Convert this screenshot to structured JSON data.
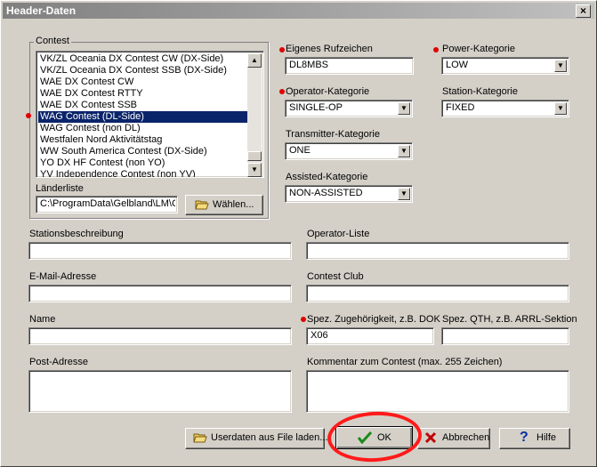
{
  "window": {
    "title": "Header-Daten",
    "close_glyph": "×"
  },
  "contest": {
    "group_label": "Contest",
    "items": [
      "VK/ZL Oceania DX Contest CW (DX-Side)",
      "VK/ZL Oceania DX Contest SSB (DX-Side)",
      "WAE DX Contest CW",
      "WAE DX Contest RTTY",
      "WAE DX Contest SSB",
      "WAG Contest (DL-Side)",
      "WAG Contest (non DL)",
      "Westfalen Nord Aktivitätstag",
      "WW South America Contest (DX-Side)",
      "YO DX HF Contest (non YO)",
      "YV Independence Contest (non YV)"
    ],
    "selected_index": 5,
    "laenderliste_label": "Länderliste",
    "laenderliste_value": "C:\\ProgramData\\Gelbland\\LM\\C",
    "waehlen_label": "Wählen..."
  },
  "fields": {
    "rufzeichen_label": "Eigenes Rufzeichen",
    "rufzeichen_value": "DL8MBS",
    "power_label": "Power-Kategorie",
    "power_value": "LOW",
    "operator_label": "Operator-Kategorie",
    "operator_value": "SINGLE-OP",
    "station_label": "Station-Kategorie",
    "station_value": "FIXED",
    "transmitter_label": "Transmitter-Kategorie",
    "transmitter_value": "ONE",
    "assisted_label": "Assisted-Kategorie",
    "assisted_value": "NON-ASSISTED",
    "stationsbeschreibung_label": "Stationsbeschreibung",
    "stationsbeschreibung_value": "",
    "operator_liste_label": "Operator-Liste",
    "operator_liste_value": "",
    "email_label": "E-Mail-Adresse",
    "email_value": "",
    "club_label": "Contest Club",
    "club_value": "",
    "name_label": "Name",
    "name_value": "",
    "dok_label": "Spez. Zugehörigkeit, z.B. DOK",
    "dok_value": "X06",
    "qth_label": "Spez. QTH, z.B. ARRL-Sektion",
    "qth_value": "",
    "post_label": "Post-Adresse",
    "post_value": "",
    "kommentar_label": "Kommentar zum Contest (max. 255 Zeichen)",
    "kommentar_value": ""
  },
  "buttons": {
    "userdaten_label": "Userdaten aus File laden...",
    "ok_label": "OK",
    "abbrechen_label": "Abbrechen",
    "hilfe_label": "Hilfe"
  },
  "colors": {
    "required_marker": "#e00000",
    "selection": "#0a246a",
    "annotation_ellipse": "#ff1a1a"
  }
}
